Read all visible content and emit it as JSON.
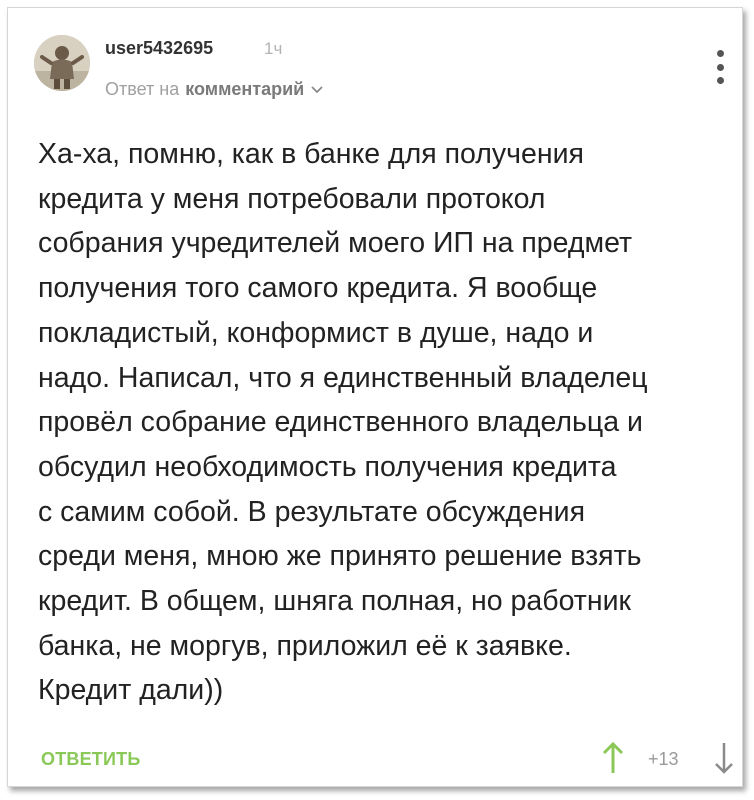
{
  "comment": {
    "author": "user5432695",
    "time": "1ч",
    "reply_prefix": "Ответ на",
    "reply_target": "комментарий",
    "text_lines": [
      "Ха-ха, помню, как в банке для получения",
      "кредита у меня потребовали протокол",
      "собрания учредителей моего ИП на предмет",
      "получения того самого кредита. Я вообще",
      "покладистый, конформист в душе, надо и",
      "надо. Написал, что я единственный владелец",
      "провёл собрание единственного владельца и",
      "обсудил необходимость получения кредита",
      "с самим собой. В результате обсуждения",
      "среди меня, мною же принято решение взять",
      "кредит. В общем, шняга полная, но работник",
      "банка, не моргув, приложил её к заявке.",
      "Кредит дали))"
    ],
    "reply_button": "ОТВЕТИТЬ",
    "votes": "+13"
  },
  "icons": {
    "avatar": "avatar-icon",
    "more": "more-vertical-icon",
    "chevron": "chevron-down-icon",
    "upvote": "arrow-up-icon",
    "downvote": "arrow-down-icon"
  },
  "colors": {
    "accent_green": "#8ac858",
    "text": "#222222",
    "muted": "#a0a0a0",
    "vote_up": "#8ac858",
    "vote_down": "#8a8a8a"
  }
}
